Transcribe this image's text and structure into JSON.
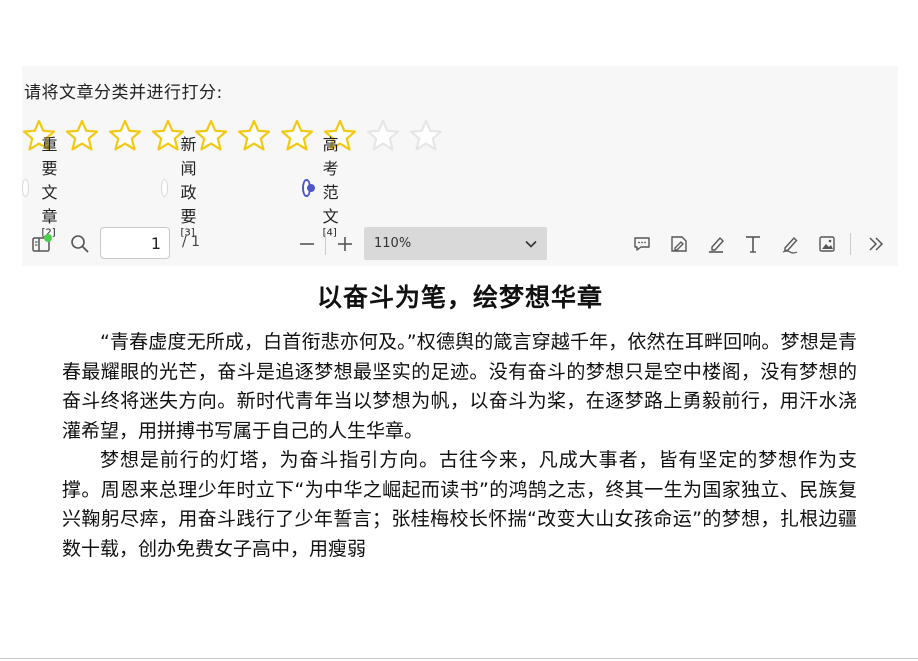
{
  "prompt": "请将文章分类并进行打分:",
  "rating": {
    "value": 8,
    "max": 10,
    "filled_color": "#f2c811",
    "empty_color": "#e6e6e6"
  },
  "categories": [
    {
      "label": "重要文章",
      "ref": "[2]",
      "selected": false
    },
    {
      "label": "新闻政要",
      "ref": "[3]",
      "selected": false
    },
    {
      "label": "高考范文",
      "ref": "[4]",
      "selected": true
    }
  ],
  "accent_color": "#4f56c8",
  "toolbar": {
    "sidebar_icon": "sidebar-toggle-icon",
    "search_icon": "search-icon",
    "page_current": "1",
    "page_total": "/ 1",
    "zoom_out": "—",
    "zoom_in": "+",
    "zoom_level": "110%",
    "tools": [
      "comment-icon",
      "sign-icon",
      "highlight-icon",
      "text-icon",
      "draw-icon",
      "image-icon",
      "more-icon"
    ]
  },
  "document": {
    "title": "以奋斗为笔，绘梦想华章",
    "paragraphs": [
      "“青春虚度无所成，白首衔悲亦何及。”权德舆的箴言穿越千年，依然在耳畔回响。梦想是青春最耀眼的光芒，奋斗是追逐梦想最坚实的足迹。没有奋斗的梦想只是空中楼阁，没有梦想的奋斗终将迷失方向。新时代青年当以梦想为帆，以奋斗为桨，在逐梦路上勇毅前行，用汗水浇灌希望，用拼搏书写属于自己的人生华章。",
      "梦想是前行的灯塔，为奋斗指引方向。古往今来，凡成大事者，皆有坚定的梦想作为支撑。周恩来总理少年时立下“为中华之崛起而读书”的鸿鹄之志，终其一生为国家独立、民族复兴鞠躬尽瘁，用奋斗践行了少年誓言；张桂梅校长怀揣“改变大山女孩命运”的梦想，扎根边疆数十载，创办免费女子高中，用瘦弱"
    ]
  }
}
